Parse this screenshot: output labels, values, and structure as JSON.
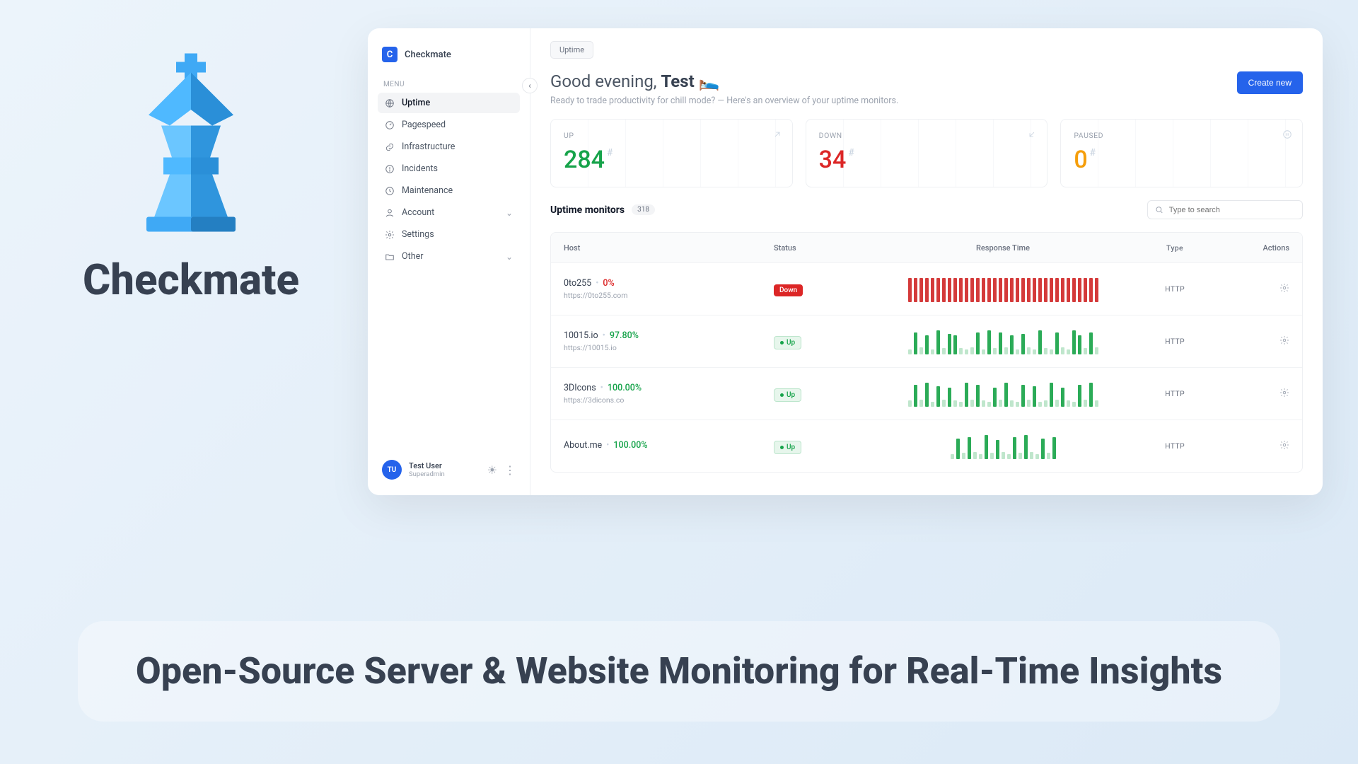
{
  "hero": {
    "title": "Checkmate",
    "tagline": "Open-Source Server & Website Monitoring for Real-Time Insights"
  },
  "brand": {
    "badge": "C",
    "name": "Checkmate"
  },
  "sidebar": {
    "menu_label": "MENU",
    "items": [
      {
        "label": "Uptime",
        "icon": "globe-icon",
        "active": true
      },
      {
        "label": "Pagespeed",
        "icon": "gauge-icon"
      },
      {
        "label": "Infrastructure",
        "icon": "link-icon"
      },
      {
        "label": "Incidents",
        "icon": "alert-icon"
      },
      {
        "label": "Maintenance",
        "icon": "clock-icon"
      },
      {
        "label": "Account",
        "icon": "user-icon",
        "chevron": true
      },
      {
        "label": "Settings",
        "icon": "gear-icon"
      },
      {
        "label": "Other",
        "icon": "folder-icon",
        "chevron": true
      }
    ],
    "user": {
      "initials": "TU",
      "name": "Test User",
      "role": "Superadmin"
    }
  },
  "tab": "Uptime",
  "greeting": {
    "prefix": "Good evening, ",
    "name": "Test",
    "emoji": "🛌",
    "sub": "Ready to trade productivity for chill mode? — Here's an overview of your uptime monitors."
  },
  "create_label": "Create new",
  "stats": {
    "up": {
      "label": "UP",
      "value": "284"
    },
    "down": {
      "label": "DOWN",
      "value": "34"
    },
    "paused": {
      "label": "PAUSED",
      "value": "0"
    }
  },
  "monitors_title": "Uptime monitors",
  "monitors_count": "318",
  "search_placeholder": "Type to search",
  "columns": {
    "host": "Host",
    "status": "Status",
    "rt": "Response Time",
    "type": "Type",
    "actions": "Actions"
  },
  "rows": [
    {
      "host": "0to255",
      "pct": "0%",
      "url": "https://0to255.com",
      "status": "Down",
      "status_kind": "down",
      "type": "HTTP"
    },
    {
      "host": "10015.io",
      "pct": "97.80%",
      "url": "https://10015.io",
      "status": "Up",
      "status_kind": "up",
      "type": "HTTP"
    },
    {
      "host": "3DIcons",
      "pct": "100.00%",
      "url": "https://3dicons.co",
      "status": "Up",
      "status_kind": "up",
      "type": "HTTP"
    },
    {
      "host": "About.me",
      "pct": "100.00%",
      "url": "",
      "status": "Up",
      "status_kind": "up",
      "type": "HTTP"
    }
  ],
  "chart_data": {
    "type": "bar",
    "note": "sparkline bar heights, qualitative (relative 0-1 scale)",
    "series": [
      {
        "name": "0to255",
        "status": "down",
        "values": [
          1,
          1,
          1,
          1,
          1,
          1,
          1,
          1,
          1,
          1,
          1,
          1,
          1,
          1,
          1,
          1,
          1,
          1,
          1,
          1,
          1,
          1,
          1,
          1,
          1,
          1,
          1,
          1,
          1,
          1,
          1,
          1,
          1,
          1
        ],
        "color": "#d43a3a"
      },
      {
        "name": "10015.io",
        "status": "up",
        "values": [
          0.2,
          0.9,
          0.3,
          0.8,
          0.2,
          1,
          0.25,
          0.85,
          0.8,
          0.25,
          0.2,
          0.3,
          0.9,
          0.2,
          1,
          0.25,
          0.9,
          0.3,
          0.8,
          0.2,
          0.85,
          0.3,
          0.2,
          1,
          0.25,
          0.2,
          0.9,
          0.3,
          0.2,
          1,
          0.8,
          0.25,
          0.9,
          0.3
        ],
        "color": "#2bab57"
      },
      {
        "name": "3DIcons",
        "status": "up",
        "values": [
          0.25,
          0.9,
          0.3,
          1,
          0.2,
          0.85,
          0.3,
          0.8,
          0.25,
          0.2,
          1,
          0.3,
          0.9,
          0.25,
          0.2,
          0.8,
          0.3,
          1,
          0.25,
          0.2,
          0.9,
          0.3,
          0.85,
          0.2,
          0.25,
          1,
          0.3,
          0.8,
          0.25,
          0.2,
          0.9,
          0.3,
          1,
          0.25
        ],
        "color": "#2bab57"
      },
      {
        "name": "About.me",
        "status": "up",
        "values": [
          0.2,
          0.85,
          0.25,
          0.9,
          0.3,
          0.2,
          1,
          0.25,
          0.8,
          0.3,
          0.2,
          0.9,
          0.25,
          1,
          0.3,
          0.2,
          0.85,
          0.25,
          0.9
        ],
        "color": "#2bab57"
      }
    ]
  }
}
